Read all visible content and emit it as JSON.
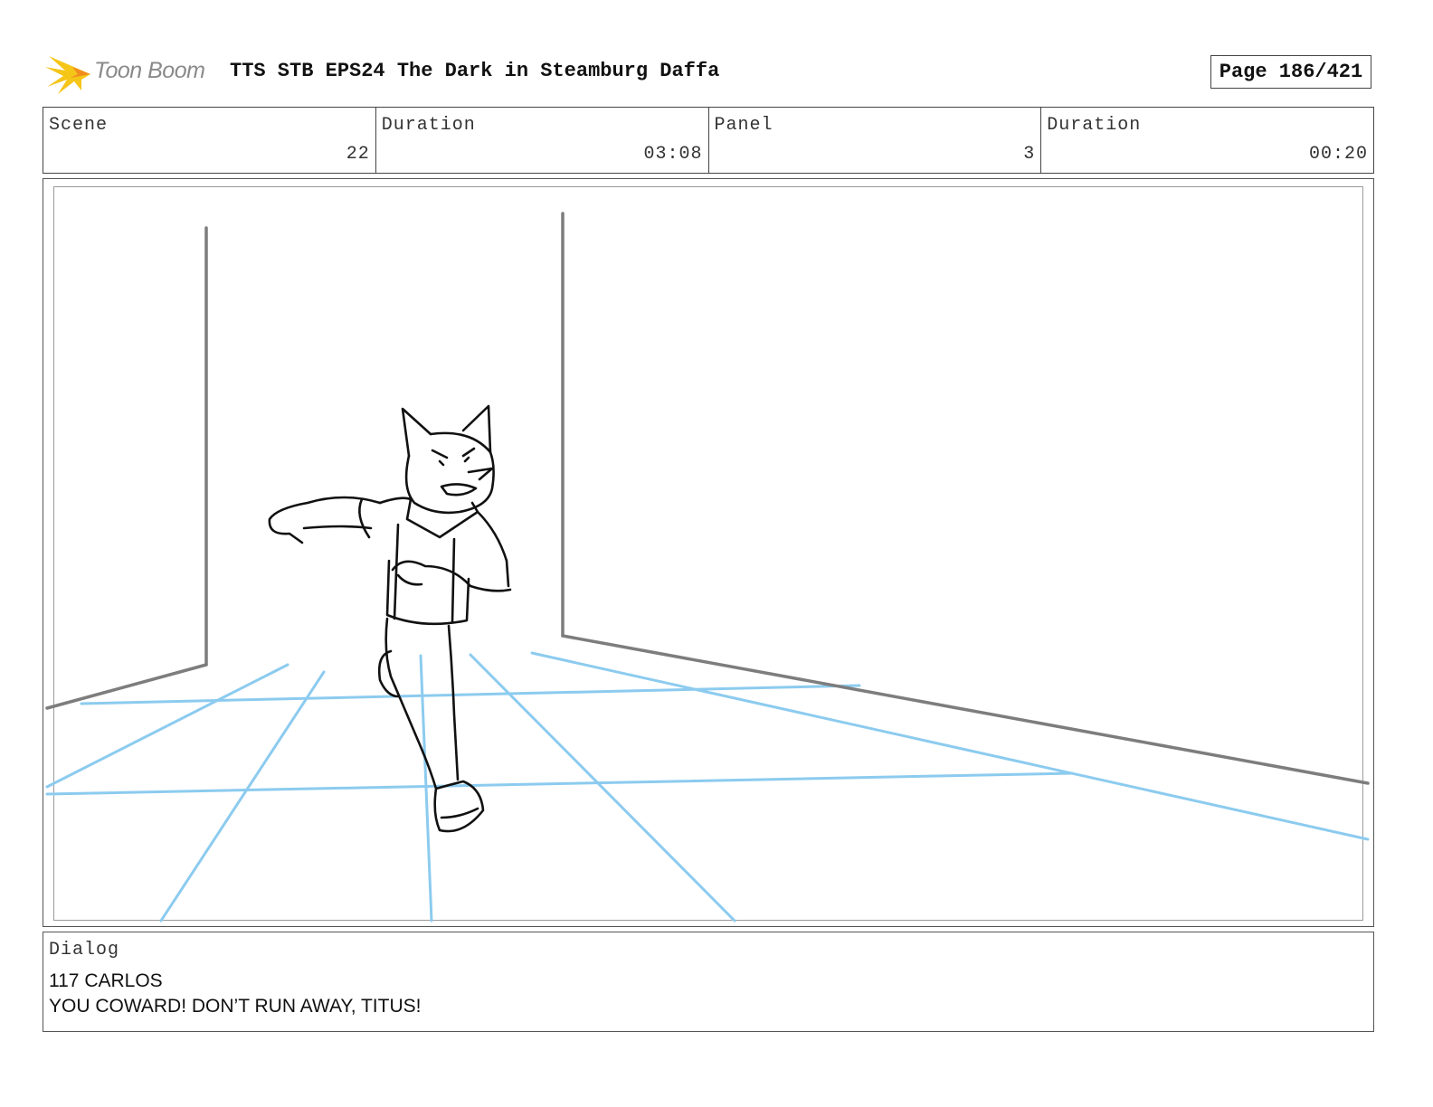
{
  "header": {
    "logo_text": "Toon Boom",
    "title": "TTS STB EPS24 The Dark in Steamburg Daffa",
    "page": "Page 186/421"
  },
  "info": {
    "scene_label": "Scene",
    "scene_value": "22",
    "scene_duration_label": "Duration",
    "scene_duration_value": "03:08",
    "panel_label": "Panel",
    "panel_value": "3",
    "panel_duration_label": "Duration",
    "panel_duration_value": "00:20"
  },
  "dialog": {
    "label": "Dialog",
    "lines": [
      "117 CARLOS",
      "YOU COWARD! DON’T RUN AWAY, TITUS!"
    ]
  },
  "colors": {
    "guide_blue": "#8ccbef",
    "wall_gray": "#7d7d7d",
    "logo_yellow": "#f5c518"
  }
}
